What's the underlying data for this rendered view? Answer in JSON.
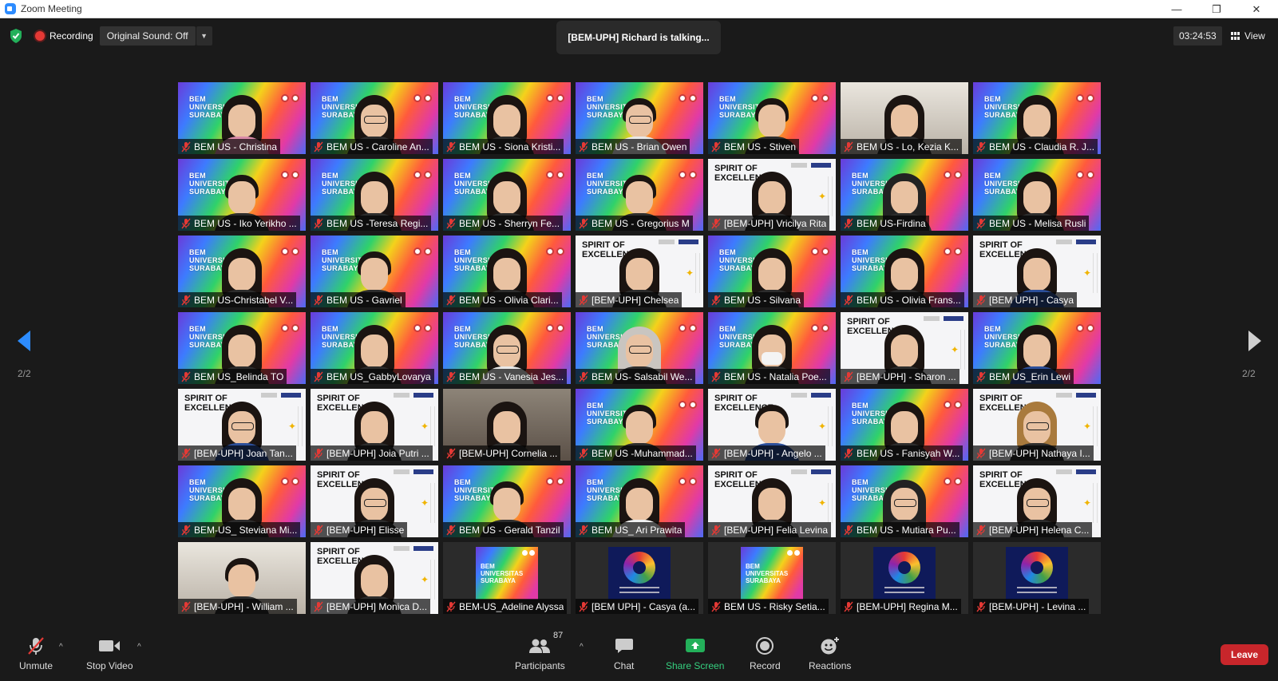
{
  "window": {
    "title": "Zoom Meeting",
    "minimize": "—",
    "maximize": "❐",
    "close": "✕"
  },
  "topbar": {
    "recording_label": "Recording",
    "sound_label": "Original Sound: Off",
    "talking_text": "[BEM-UPH] Richard is talking...",
    "timer": "03:24:53",
    "view_label": "View"
  },
  "pagination": {
    "left_indicator": "2/2",
    "right_indicator": "2/2"
  },
  "colors": {
    "accent_blue": "#2d8cff",
    "share_green": "#35d07f",
    "leave_red": "#c8262b",
    "mute_red": "#e53935"
  },
  "participants": [
    {
      "name": "BEM US - Christina",
      "bg": "bem",
      "avatar": "long pink"
    },
    {
      "name": "BEM US - Caroline An...",
      "bg": "bem",
      "avatar": "long glasses"
    },
    {
      "name": "BEM US - Siona Kristi...",
      "bg": "bem",
      "avatar": "long"
    },
    {
      "name": "BEM US - Brian Owen",
      "bg": "bem",
      "avatar": "shorthair glasses white"
    },
    {
      "name": "BEM US - Stiven",
      "bg": "bem",
      "avatar": "shorthair"
    },
    {
      "name": "BEM US - Lo, Kezia K...",
      "bg": "wall",
      "avatar": "long"
    },
    {
      "name": "BEM US - Claudia R. J...",
      "bg": "bem",
      "avatar": "long"
    },
    {
      "name": "BEM US - Iko Yerikho ...",
      "bg": "bem",
      "avatar": "shorthair"
    },
    {
      "name": "BEM US -Teresa Regi...",
      "bg": "bem",
      "avatar": "long"
    },
    {
      "name": "BEM US - Sherryn Fe...",
      "bg": "bem",
      "avatar": "long"
    },
    {
      "name": "BEM US - Gregorius M",
      "bg": "bem",
      "avatar": "shorthair"
    },
    {
      "name": "[BEM-UPH] Vricilya Rita",
      "bg": "soe",
      "avatar": "long"
    },
    {
      "name": "BEM US-Firdina",
      "bg": "bem",
      "avatar": "hijab-dark"
    },
    {
      "name": "BEM US - Melisa Rusli",
      "bg": "bem",
      "avatar": "long"
    },
    {
      "name": "BEM US-Christabel V...",
      "bg": "bem",
      "avatar": "long"
    },
    {
      "name": "BEM US - Gavriel",
      "bg": "bem",
      "avatar": "shorthair"
    },
    {
      "name": "BEM US - Olivia Clari...",
      "bg": "bem",
      "avatar": "long"
    },
    {
      "name": "[BEM-UPH] Chelsea",
      "bg": "soe",
      "avatar": "long"
    },
    {
      "name": "BEM US - Silvana",
      "bg": "bem",
      "avatar": "long"
    },
    {
      "name": "BEM US - Olivia Frans...",
      "bg": "bem",
      "avatar": "long"
    },
    {
      "name": "[BEM UPH] - Casya",
      "bg": "soe",
      "avatar": "long blue"
    },
    {
      "name": "BEM US_Belinda TO",
      "bg": "bem",
      "avatar": "long"
    },
    {
      "name": "BEM US_GabbyLovarya",
      "bg": "bem",
      "avatar": "long"
    },
    {
      "name": "BEM US - Vanesia Jes...",
      "bg": "bem",
      "avatar": "long glasses white"
    },
    {
      "name": "BEM US- Salsabil We...",
      "bg": "bem",
      "avatar": "hijab glasses"
    },
    {
      "name": "BEM US - Natalia Poe...",
      "bg": "bem",
      "avatar": "long mask"
    },
    {
      "name": "[BEM-UPH] - Sharon ...",
      "bg": "soe",
      "avatar": "long"
    },
    {
      "name": "BEM US_Erin Lewi",
      "bg": "bem",
      "avatar": "long blue"
    },
    {
      "name": "[BEM-UPH] Joan Tan...",
      "bg": "soe",
      "avatar": "long glasses blue"
    },
    {
      "name": "[BEM-UPH] Joia Putri ...",
      "bg": "soe",
      "avatar": "long"
    },
    {
      "name": "[BEM-UPH] Cornelia ...",
      "bg": "room",
      "avatar": "long"
    },
    {
      "name": "BEM US -Muhammad...",
      "bg": "bem",
      "avatar": "shorthair"
    },
    {
      "name": "[BEM-UPH] - Angelo ...",
      "bg": "soe",
      "avatar": "shorthair blue"
    },
    {
      "name": "BEM US - Fanisyah W...",
      "bg": "bem",
      "avatar": "long"
    },
    {
      "name": "[BEM-UPH] Nathaya I...",
      "bg": "soe",
      "avatar": "blonde glasses"
    },
    {
      "name": "BEM-US_ Steviana Mi...",
      "bg": "bem",
      "avatar": "long"
    },
    {
      "name": "[BEM-UPH] Elisse",
      "bg": "soe",
      "avatar": "long glasses"
    },
    {
      "name": "BEM US - Gerald Tanzil",
      "bg": "bem",
      "avatar": "shorthair"
    },
    {
      "name": "BEM US_ Ari Prawita",
      "bg": "bem",
      "avatar": "long light"
    },
    {
      "name": "[BEM-UPH] Felia Levina",
      "bg": "soe",
      "avatar": "long"
    },
    {
      "name": "BEM US - Mutiara Pu...",
      "bg": "bem",
      "avatar": "hijab-dark glasses"
    },
    {
      "name": "[BEM-UPH] Helena C...",
      "bg": "soe",
      "avatar": "long glasses"
    },
    {
      "name": "[BEM-UPH] - William ...",
      "bg": "wall",
      "avatar": "shorthair"
    },
    {
      "name": "[BEM-UPH] Monica D...",
      "bg": "soe",
      "avatar": "long"
    },
    {
      "name": "BEM-US_Adeline Alyssa",
      "bg": "dark",
      "avatar": "bem-mini"
    },
    {
      "name": "[BEM UPH] - Casya (a...",
      "bg": "dark",
      "avatar": "logo"
    },
    {
      "name": "BEM US - Risky Setia...",
      "bg": "dark",
      "avatar": "bem-mini"
    },
    {
      "name": "[BEM-UPH] Regina M...",
      "bg": "dark",
      "avatar": "logo"
    },
    {
      "name": "[BEM-UPH] - Levina ...",
      "bg": "dark",
      "avatar": "logo"
    }
  ],
  "backgrounds": {
    "bem_lines": [
      "BEM",
      "UNIVERSITAS",
      "SURABAYA"
    ],
    "soe_lines": [
      "SPIRIT OF",
      "EXCELLENCE"
    ]
  },
  "toolbar": {
    "unmute": "Unmute",
    "stop_video": "Stop Video",
    "participants": "Participants",
    "participants_count": "87",
    "chat": "Chat",
    "share_screen": "Share Screen",
    "record": "Record",
    "reactions": "Reactions",
    "leave": "Leave"
  }
}
